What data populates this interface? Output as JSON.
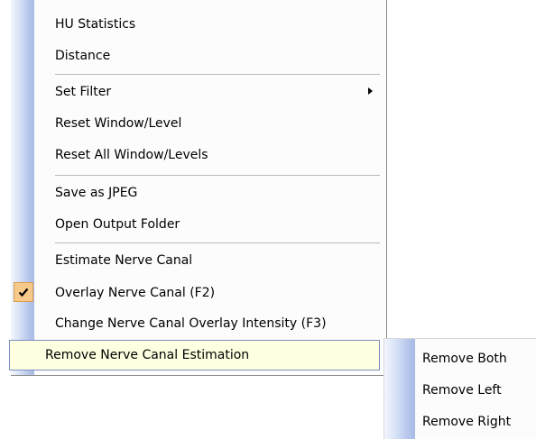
{
  "context_menu": {
    "items": [
      {
        "label": "HU Statistics"
      },
      {
        "label": "Distance"
      },
      {
        "label": "Set Filter",
        "has_submenu": true
      },
      {
        "label": "Reset Window/Level"
      },
      {
        "label": "Reset All Window/Levels"
      },
      {
        "label": "Save as JPEG"
      },
      {
        "label": "Open Output Folder"
      },
      {
        "label": "Estimate Nerve Canal"
      },
      {
        "label": "Overlay Nerve Canal (F2)",
        "checked": true
      },
      {
        "label": "Change Nerve Canal Overlay Intensity (F3)"
      },
      {
        "label": "Remove Nerve Canal Estimation",
        "highlighted": true,
        "has_submenu": true
      }
    ]
  },
  "submenu": {
    "items": [
      {
        "label": "Remove Both"
      },
      {
        "label": "Remove Left"
      },
      {
        "label": "Remove Right"
      }
    ]
  },
  "colors": {
    "gutter": "#b7c7ec",
    "highlight_background": "#ffffe1",
    "highlight_border": "#7c8fc0",
    "check_background": "#f7c98a"
  },
  "icons": {
    "checked_item": "checkmark-icon",
    "submenu_arrow": "submenu-arrow-icon"
  }
}
